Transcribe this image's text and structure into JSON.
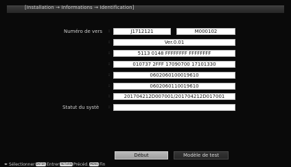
{
  "header": {
    "breadcrumb": "[Installation → Informations → Identification]"
  },
  "rows": {
    "version_label": "Numéro de vers",
    "status_label": "Statut du systè"
  },
  "fields": {
    "version_a": "J1712121",
    "version_b": "M000102",
    "row2": "Ver.0.01",
    "row3": "5113 0148 FFFFFFFF FFFFFFFF",
    "row4": "010737 2FFF 17090700 17101330",
    "row5": "0602060100019610",
    "row6": "0602060110019610",
    "row7": "201704212D007001/201704212D017001",
    "status": ""
  },
  "buttons": {
    "debut": "Début",
    "test_pattern": "Modèle de test"
  },
  "footer": {
    "arrows": "◂▸",
    "select": "Sélectionner",
    "enter_key": "ENTER",
    "enter": "Entrer",
    "return_key": "RETURN",
    "prev": "Précéd.",
    "menu_key": "MENU",
    "end": "Fin"
  }
}
